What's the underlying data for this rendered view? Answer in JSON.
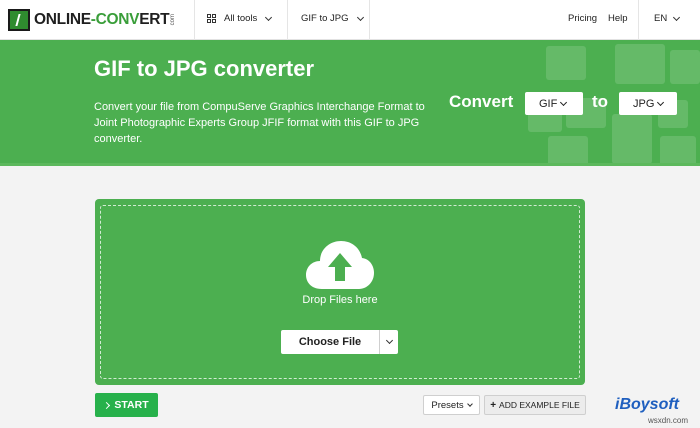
{
  "nav": {
    "logo_text_a": "ONLINE",
    "logo_text_b": "-CONV",
    "logo_text_c": "ERT",
    "logo_suffix": "com",
    "all_tools_label": "All tools",
    "gif_to_jpg_label": "GIF to JPG",
    "pricing_label": "Pricing",
    "help_label": "Help",
    "language_label": "EN"
  },
  "hero": {
    "title": "GIF to JPG converter",
    "description": "Convert your file from CompuServe Graphics Interchange Format to Joint Photographic Experts Group JFIF format with this GIF to JPG converter.",
    "convert_label": "Convert",
    "from_format": "GIF",
    "to_label": "to",
    "to_format": "JPG"
  },
  "upload": {
    "drop_text": "Drop Files here",
    "choose_label": "Choose File"
  },
  "actions": {
    "start_label": "START",
    "presets_label": "Presets",
    "example_label": "ADD EXAMPLE FILE"
  },
  "watermark": {
    "brand": "iBoysoft",
    "site": "wsxdn.com"
  },
  "colors": {
    "brand_green": "#4caf50",
    "start_green": "#27b14b",
    "background": "#f3f3f3"
  },
  "icons": [
    "all-tools-grid-icon",
    "chevron-down-icon",
    "cloud-upload-icon",
    "chevron-right-icon",
    "plus-icon"
  ]
}
